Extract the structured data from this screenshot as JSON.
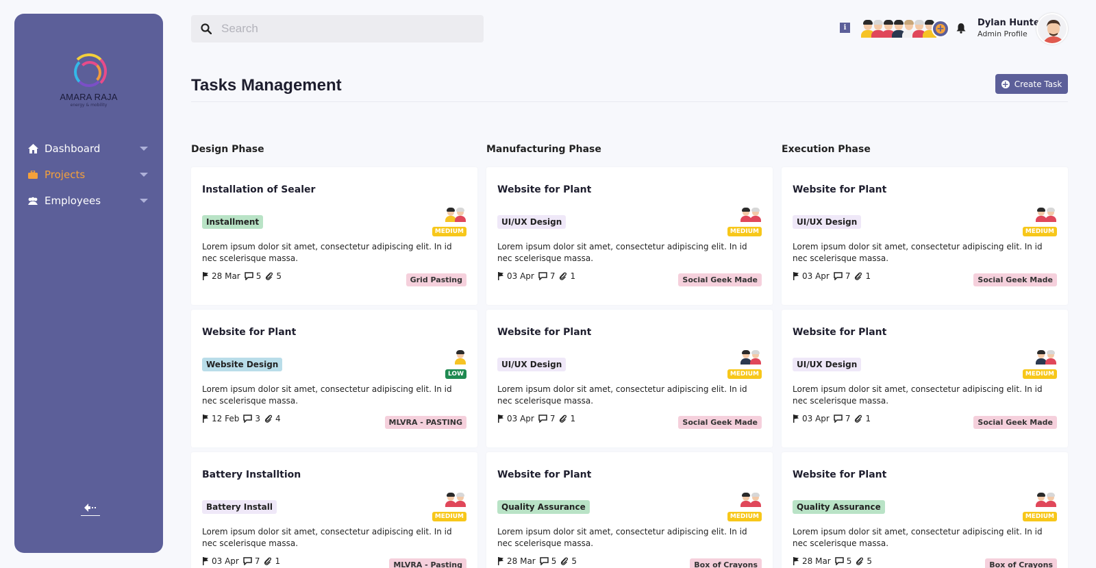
{
  "brand": {
    "name": "AMARA RAJA",
    "tagline": "energy & mobility"
  },
  "sidebar": {
    "items": [
      {
        "label": "Dashboard",
        "icon": "home-icon",
        "active": false
      },
      {
        "label": "Projects",
        "icon": "briefcase-icon",
        "active": true
      },
      {
        "label": "Employees",
        "icon": "users-icon",
        "active": false
      }
    ]
  },
  "search": {
    "placeholder": "Search",
    "value": ""
  },
  "user": {
    "name": "Dylan Hunter",
    "role": "Admin Profile"
  },
  "page": {
    "title": "Tasks Management",
    "create_label": "Create Task"
  },
  "colors": {
    "accent": "#5c5f99",
    "active_nav": "#f5a13a",
    "medium": "#f7c71a",
    "low": "#1f8a51"
  },
  "columns": [
    {
      "title": "Design Phase",
      "cards": [
        {
          "title": "Installation of Sealer",
          "tag": "Installment",
          "tag_color": "#b9e3c6",
          "priority": "MEDIUM",
          "desc": "Lorem ipsum dolor sit amet, consectetur adipiscing elit. In id nec scelerisque massa.",
          "date": "28 Mar",
          "comments": "5",
          "attachments": "5",
          "label": "Grid Pasting"
        },
        {
          "title": "Website for Plant",
          "tag": "Website Design",
          "tag_color": "#b9dde9",
          "priority": "LOW",
          "desc": "Lorem ipsum dolor sit amet, consectetur adipiscing elit. In id nec scelerisque massa.",
          "date": "12 Feb",
          "comments": "3",
          "attachments": "4",
          "label": "MLVRA - PASTING"
        },
        {
          "title": "Battery Installtion",
          "tag": "Battery Install",
          "tag_color": "#efe8f8",
          "priority": "MEDIUM",
          "desc": "Lorem ipsum dolor sit amet, consectetur adipiscing elit. In id nec scelerisque massa.",
          "date": "03 Apr",
          "comments": "7",
          "attachments": "1",
          "label": "MLVRA - Pasting"
        }
      ]
    },
    {
      "title": "Manufacturing Phase",
      "cards": [
        {
          "title": "Website for Plant",
          "tag": "UI/UX Design",
          "tag_color": "#efe8f8",
          "priority": "MEDIUM",
          "desc": "Lorem ipsum dolor sit amet, consectetur adipiscing elit. In id nec scelerisque massa.",
          "date": "03 Apr",
          "comments": "7",
          "attachments": "1",
          "label": "Social Geek Made"
        },
        {
          "title": "Website for Plant",
          "tag": "UI/UX Design",
          "tag_color": "#efe8f8",
          "priority": "MEDIUM",
          "desc": "Lorem ipsum dolor sit amet, consectetur adipiscing elit. In id nec scelerisque massa.",
          "date": "03 Apr",
          "comments": "7",
          "attachments": "1",
          "label": "Social Geek Made"
        },
        {
          "title": "Website for Plant",
          "tag": "Quality Assurance",
          "tag_color": "#b9e3c6",
          "priority": "MEDIUM",
          "desc": "Lorem ipsum dolor sit amet, consectetur adipiscing elit. In id nec scelerisque massa.",
          "date": "28 Mar",
          "comments": "5",
          "attachments": "5",
          "label": "Box of Crayons"
        }
      ]
    },
    {
      "title": "Execution Phase",
      "cards": [
        {
          "title": "Website for Plant",
          "tag": "UI/UX Design",
          "tag_color": "#efe8f8",
          "priority": "MEDIUM",
          "desc": "Lorem ipsum dolor sit amet, consectetur adipiscing elit. In id nec scelerisque massa.",
          "date": "03 Apr",
          "comments": "7",
          "attachments": "1",
          "label": "Social Geek Made"
        },
        {
          "title": "Website for Plant",
          "tag": "UI/UX Design",
          "tag_color": "#efe8f8",
          "priority": "MEDIUM",
          "desc": "Lorem ipsum dolor sit amet, consectetur adipiscing elit. In id nec scelerisque massa.",
          "date": "03 Apr",
          "comments": "7",
          "attachments": "1",
          "label": "Social Geek Made"
        },
        {
          "title": "Website for Plant",
          "tag": "Quality Assurance",
          "tag_color": "#b9e3c6",
          "priority": "MEDIUM",
          "desc": "Lorem ipsum dolor sit amet, consectetur adipiscing elit. In id nec scelerisque massa.",
          "date": "28 Mar",
          "comments": "5",
          "attachments": "5",
          "label": "Box of Crayons"
        }
      ]
    }
  ]
}
